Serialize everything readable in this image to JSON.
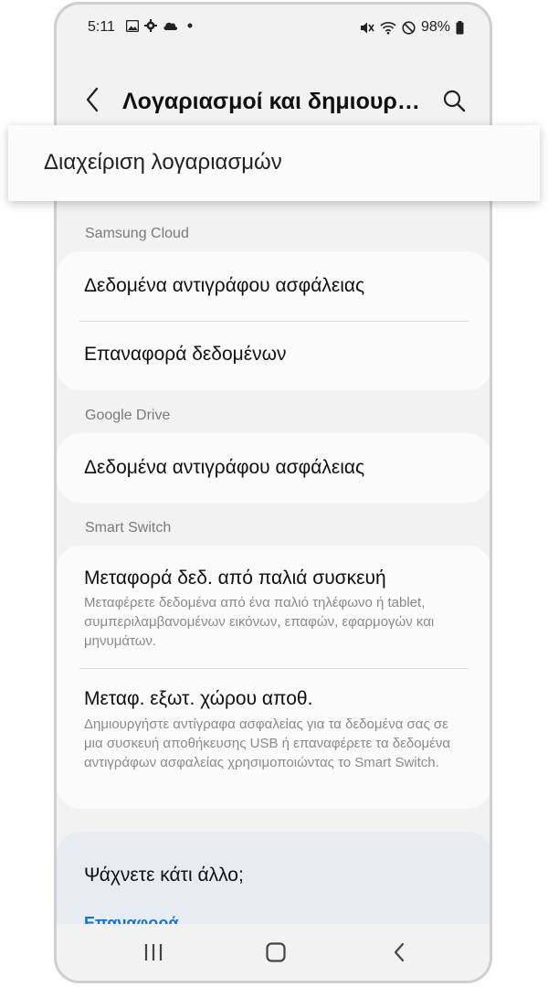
{
  "status_bar": {
    "time": "5:11",
    "left_icons": [
      "image-icon",
      "gear-icon",
      "cloud-icon",
      "dot-icon"
    ],
    "right_icons": [
      "mute-icon",
      "wifi-icon",
      "blocked-icon",
      "battery-icon"
    ],
    "battery": "98%"
  },
  "app_bar": {
    "title": "Λογαριασμοί και δημιουρ…"
  },
  "popup": {
    "label": "Διαχείριση λογαριασμών"
  },
  "sections": [
    {
      "label": "Samsung Cloud",
      "items": [
        {
          "title": "Δεδομένα αντιγράφου ασφάλειας"
        },
        {
          "title": "Επαναφορά δεδομένων"
        }
      ]
    },
    {
      "label": "Google Drive",
      "items": [
        {
          "title": "Δεδομένα αντιγράφου ασφάλειας"
        }
      ]
    },
    {
      "label": "Smart Switch",
      "items": [
        {
          "title": "Μεταφορά δεδ. από παλιά συσκευή",
          "subtitle": "Μεταφέρετε δεδομένα από ένα παλιό τηλέφωνο ή tablet, συμπεριλαμβανομένων εικόνων, επαφών, εφαρμογών και μηνυμάτων."
        },
        {
          "title": "Μεταφ. εξωτ. χώρου αποθ.",
          "subtitle": "Δημιουργήστε αντίγραφα ασφαλείας για τα δεδομένα σας σε μια συσκευή αποθήκευσης USB ή επαναφέρετε τα δεδομένα αντιγράφων ασφαλείας χρησιμοποιώντας το Smart Switch."
        }
      ]
    }
  ],
  "help": {
    "title": "Ψάχνετε κάτι άλλο;",
    "link": "Επαναφορά"
  }
}
